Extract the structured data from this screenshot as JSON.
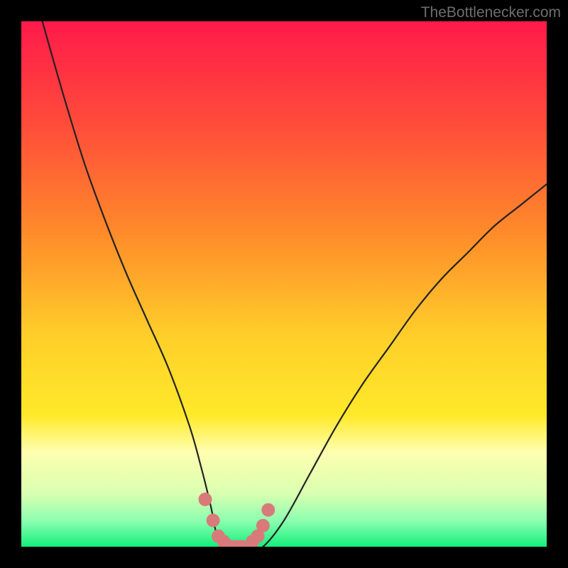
{
  "watermark": "TheBottlenecker.com",
  "colors": {
    "bg": "#000000",
    "gradient_top": "#ff1a4a",
    "gradient_mid_orange": "#ff8a2a",
    "gradient_yellow": "#ffe92a",
    "gradient_pale_yellow": "#ffffb0",
    "gradient_bottom_green": "#13f07c",
    "curve": "#222222",
    "markers": "#d97a7a"
  },
  "chart_data": {
    "type": "line",
    "title": "",
    "xlabel": "",
    "ylabel": "",
    "xlim": [
      0,
      100
    ],
    "ylim": [
      0,
      100
    ],
    "series": [
      {
        "name": "bottleneck-curve",
        "x": [
          4,
          8,
          12,
          16,
          20,
          24,
          28,
          32,
          34,
          36,
          37,
          38,
          40,
          42,
          44,
          46,
          50,
          55,
          60,
          65,
          70,
          75,
          80,
          85,
          90,
          95,
          100
        ],
        "y": [
          100,
          86,
          73,
          62,
          52,
          43,
          34,
          23,
          16,
          8,
          3,
          0,
          0,
          0,
          0,
          0,
          5,
          14,
          23,
          31,
          38,
          45,
          51,
          56,
          61,
          65,
          69
        ]
      }
    ],
    "markers": {
      "name": "sample-points",
      "x": [
        35,
        36.5,
        37.5,
        38.5,
        40,
        41,
        42,
        44,
        45,
        46,
        47
      ],
      "y": [
        9,
        5,
        2,
        1,
        0,
        0,
        0,
        1,
        2,
        4,
        7
      ]
    },
    "gradient_stops": [
      {
        "offset": 0,
        "color": "#ff1a4a"
      },
      {
        "offset": 20,
        "color": "#ff4d3a"
      },
      {
        "offset": 40,
        "color": "#ff8a2a"
      },
      {
        "offset": 60,
        "color": "#ffcf2a"
      },
      {
        "offset": 75,
        "color": "#ffe92a"
      },
      {
        "offset": 82,
        "color": "#ffffb0"
      },
      {
        "offset": 90,
        "color": "#d8ffb0"
      },
      {
        "offset": 95,
        "color": "#8dffb0"
      },
      {
        "offset": 100,
        "color": "#13f07c"
      }
    ]
  }
}
